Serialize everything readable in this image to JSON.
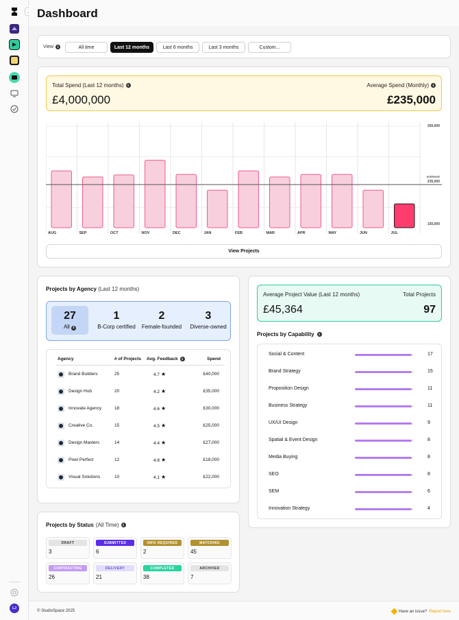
{
  "page": {
    "title": "Dashboard"
  },
  "filter": {
    "view_label": "View",
    "options": [
      "All time",
      "Last 12 months",
      "Last 6 months",
      "Last 3 months",
      "Custom..."
    ],
    "selected": "Last 12 months"
  },
  "spend": {
    "total_label": "Total Spend (Last 12 months)",
    "total_value": "£4,000,000",
    "avg_label": "Average Spend (Monthly)",
    "avg_value": "£235,000",
    "view_projects_label": "View Projects"
  },
  "chart_data": {
    "type": "bar",
    "categories": [
      "AUG",
      "SEP",
      "OCT",
      "NOV",
      "DEC",
      "JAN",
      "FEB",
      "MAR",
      "APR",
      "MAY",
      "JUN",
      "JUL"
    ],
    "values": [
      262000,
      250000,
      254000,
      283000,
      255000,
      224000,
      262000,
      250000,
      255000,
      255000,
      224000,
      197000
    ],
    "highlight_index": 11,
    "average": 235000,
    "average_label": "AVERAGE",
    "y_ticks": [
      "350,000",
      "235,000",
      "150,000"
    ],
    "ylim": [
      150000,
      350000
    ],
    "bar_color": "#f8cfdc",
    "bar_edge_color": "#ee5e86",
    "highlight_color": "#ff3d6c",
    "title": "",
    "xlabel": "",
    "ylabel": ""
  },
  "agency": {
    "title": "Projects by Agency",
    "title_suffix": "(Last 12 months)",
    "stats": [
      {
        "num": "27",
        "label": "All"
      },
      {
        "num": "1",
        "label": "B-Corp certified"
      },
      {
        "num": "2",
        "label": "Female-founded"
      },
      {
        "num": "3",
        "label": "Diverse-owned"
      }
    ],
    "columns": [
      "Agency",
      "# of Projects",
      "Avg. Feedback",
      "Spend"
    ],
    "rows": [
      {
        "name": "Brand Builders",
        "projects": "25",
        "feedback": "4.7",
        "spend": "£40,000"
      },
      {
        "name": "Design Hub",
        "projects": "20",
        "feedback": "4.2",
        "spend": "£35,000"
      },
      {
        "name": "Innovate Agency",
        "projects": "18",
        "feedback": "4.6",
        "spend": "£30,000"
      },
      {
        "name": "Creative Co.",
        "projects": "15",
        "feedback": "4.5",
        "spend": "£25,000"
      },
      {
        "name": "Design Masters",
        "projects": "14",
        "feedback": "4.4",
        "spend": "£27,000"
      },
      {
        "name": "Pixel Perfect",
        "projects": "12",
        "feedback": "4.8",
        "spend": "£18,000"
      },
      {
        "name": "Visual Solutions",
        "projects": "10",
        "feedback": "4.1",
        "spend": "£22,000"
      }
    ]
  },
  "avg_project": {
    "label": "Average Project Value (Last 12 months)",
    "value": "£45,364",
    "total_label": "Total Projects",
    "total_value": "97"
  },
  "capability": {
    "title": "Projects by Capability",
    "rows": [
      {
        "label": "Social & Content",
        "value": "17"
      },
      {
        "label": "Brand Strategy",
        "value": "15"
      },
      {
        "label": "Proposition Design",
        "value": "11"
      },
      {
        "label": "Business Strategy",
        "value": "11"
      },
      {
        "label": "UX/UI Design",
        "value": "9"
      },
      {
        "label": "Spatial & Event Design",
        "value": "8"
      },
      {
        "label": "Media Buying",
        "value": "8"
      },
      {
        "label": "SEO",
        "value": "8"
      },
      {
        "label": "SEM",
        "value": "6"
      },
      {
        "label": "Innovation Strategy",
        "value": "4"
      }
    ],
    "bar_color": "#b57cf0"
  },
  "status": {
    "title": "Projects by Status",
    "title_suffix": "(All Time)",
    "items": [
      {
        "label": "DRAFT",
        "count": "3",
        "bg": "#e4e4e4",
        "fg": "#333333"
      },
      {
        "label": "SUBMITTED",
        "count": "6",
        "bg": "#5b2de8",
        "fg": "#ffffff"
      },
      {
        "label": "INFO REQUIRED",
        "count": "2",
        "bg": "#b39130",
        "fg": "#ffffff"
      },
      {
        "label": "MATCHING",
        "count": "45",
        "bg": "#b39130",
        "fg": "#ffffff"
      },
      {
        "label": "CONTRACTING",
        "count": "26",
        "bg": "#c49af2",
        "fg": "#ffffff"
      },
      {
        "label": "DELIVERY",
        "count": "21",
        "bg": "#e3dcfb",
        "fg": "#6a4fd8"
      },
      {
        "label": "COMPLETED",
        "count": "38",
        "bg": "#2bd39f",
        "fg": "#ffffff"
      },
      {
        "label": "ARCHIVED",
        "count": "7",
        "bg": "#e4e4e4",
        "fg": "#333333"
      }
    ]
  },
  "footer": {
    "copyright": "© StudioSpace 2025",
    "issue_text": "Have an issue?",
    "report_link": "Report here"
  },
  "sidebar": {
    "user_initials": "LJ"
  }
}
